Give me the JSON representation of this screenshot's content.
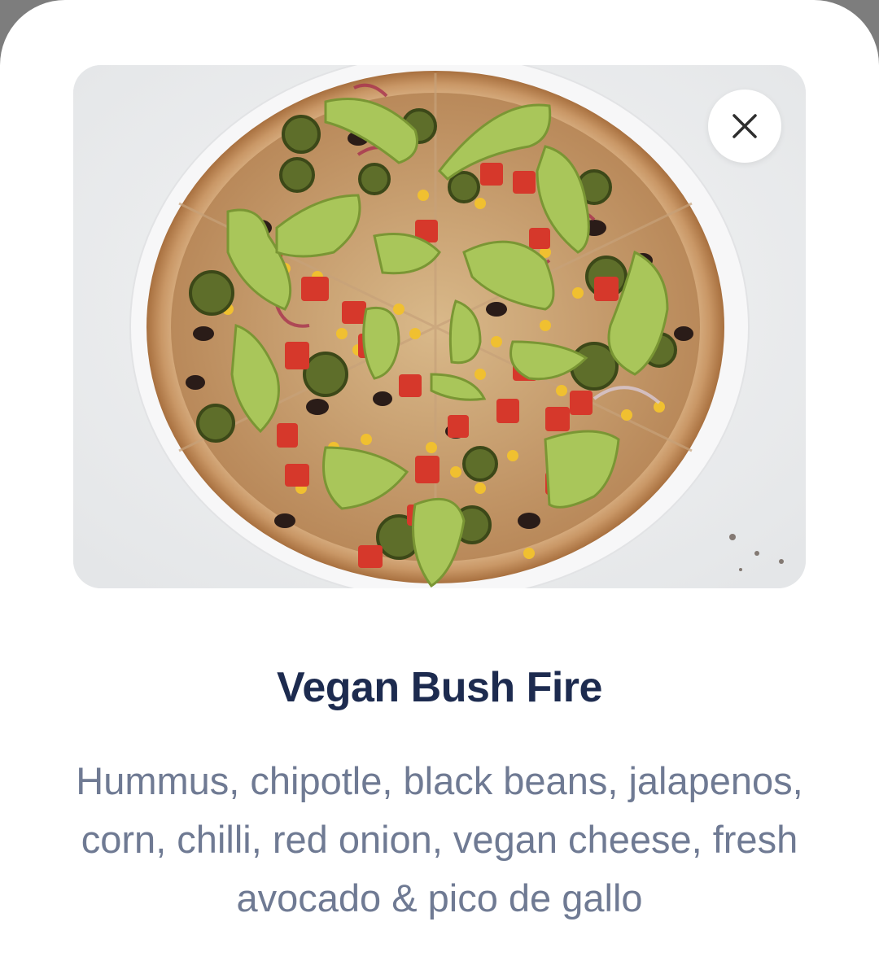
{
  "dialog": {
    "image_alt": "Vegan Bush Fire pizza",
    "close_icon": "close-icon",
    "title": "Vegan Bush Fire",
    "description": "Hummus, chipotle, black beans, jalapenos, corn, chilli, red onion, vegan cheese, fresh avocado & pico de gallo"
  },
  "colors": {
    "title": "#1d2b4f",
    "description": "#6f7a93",
    "sheet_background": "#ffffff",
    "backdrop": "#7d7d7d"
  }
}
